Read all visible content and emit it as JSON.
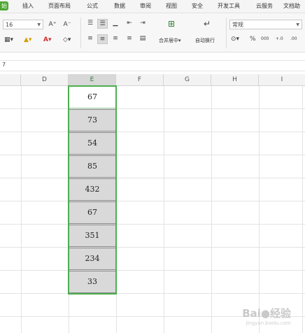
{
  "menu": {
    "active_tab": "始",
    "tabs": [
      "插入",
      "页面布局",
      "公式",
      "数据",
      "审阅",
      "视图",
      "安全",
      "开发工具",
      "云服务",
      "文档助"
    ]
  },
  "ribbon": {
    "font_size": "16",
    "font_grow": "A⁺",
    "font_shrink": "A⁻",
    "merge_label": "合并居中",
    "wrap_label": "自动换行",
    "number_format": "常规",
    "percent": "%",
    "thousands": "000",
    "inc_decimal": "+.0",
    "dec_decimal": ".00"
  },
  "formula_bar": {
    "name_box": "7"
  },
  "columns": [
    "D",
    "E",
    "F",
    "G",
    "H",
    "I"
  ],
  "selected_column": "E",
  "cells_e": [
    "67",
    "73",
    "54",
    "85",
    "432",
    "67",
    "351",
    "234",
    "33"
  ],
  "watermark": {
    "brand": "Bai●经验",
    "url": "jingyan.baidu.com"
  },
  "colors": {
    "accent": "#4caf50",
    "tab_active": "#4fa832",
    "selected_fill": "#d9d9d9"
  }
}
